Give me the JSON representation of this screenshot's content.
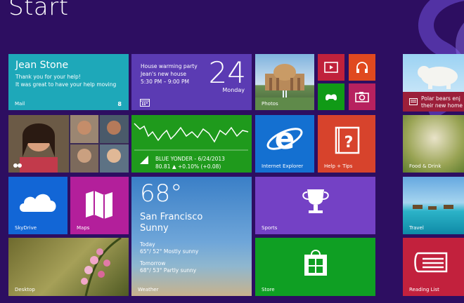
{
  "start_title": "Start",
  "mail": {
    "sender": "Jean Stone",
    "line1": "Thank you for your help!",
    "line2": "It was great to have your help moving",
    "label": "Mail",
    "count": "8"
  },
  "calendar": {
    "event": "House warming party",
    "location": "Jean's new house",
    "time": "5:30 PM – 9:00 PM",
    "day": "24",
    "weekday": "Monday"
  },
  "photos": {
    "label": "Photos"
  },
  "finance": {
    "line1": "BLUE YONDER - 6/24/2013",
    "line2": "80.81  ▲ +0.10% (+0.08)"
  },
  "ie": {
    "label": "Internet Explorer"
  },
  "help": {
    "label": "Help + Tips"
  },
  "skydrive": {
    "label": "SkyDrive"
  },
  "maps": {
    "label": "Maps"
  },
  "weather": {
    "temp": "68°",
    "city": "San Francisco",
    "condition": "Sunny",
    "today_label": "Today",
    "today": "65°/ 52° Mostly sunny",
    "tomorrow_label": "Tomorrow",
    "tomorrow": "68°/ 53° Partly sunny",
    "label": "Weather"
  },
  "sports": {
    "label": "Sports"
  },
  "desktop": {
    "label": "Desktop"
  },
  "store": {
    "label": "Store"
  },
  "news": {
    "line1": "Polar bears enj",
    "line2": "their new home"
  },
  "food": {
    "label": "Food & Drink"
  },
  "travel": {
    "label": "Travel"
  },
  "reading": {
    "label": "Reading List"
  },
  "colors": {
    "background": "#2d0e61",
    "mail": "#1ea8b9",
    "finance": "#1f9a1c",
    "ie": "#1470d1",
    "help": "#d7432c"
  }
}
